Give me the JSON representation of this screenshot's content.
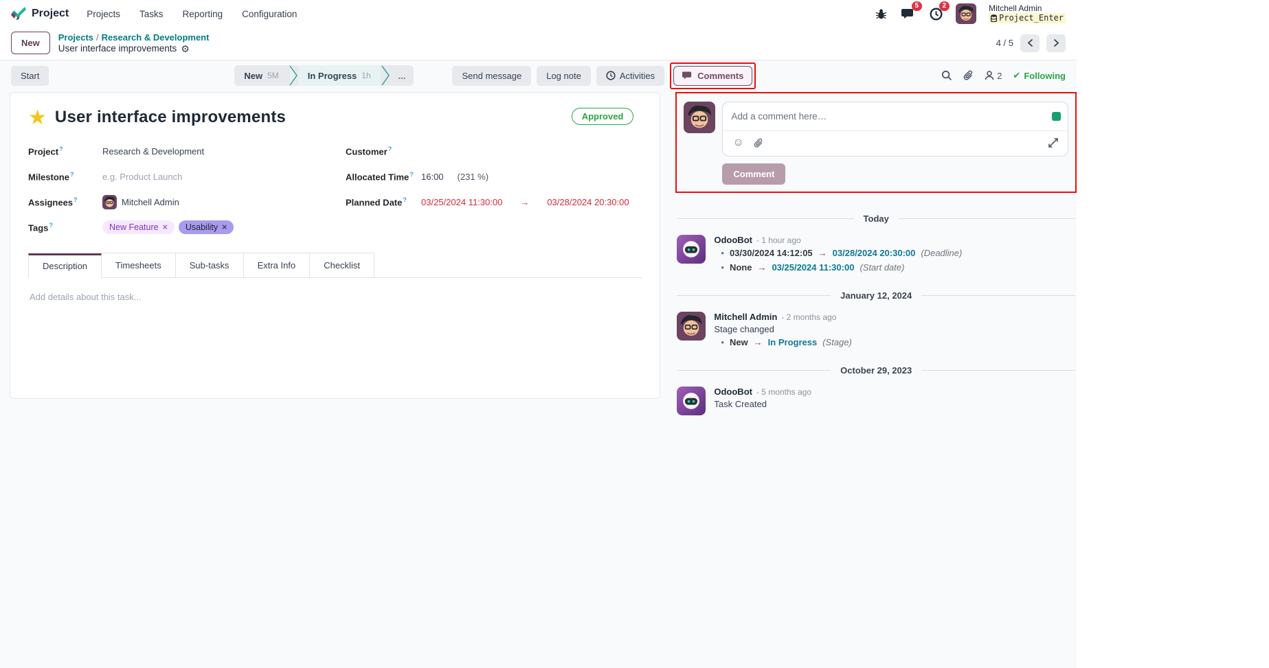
{
  "icons": {
    "star": "★",
    "gear": "⚙",
    "check": "✔",
    "smiley": "☺",
    "arrow": "→",
    "bullet": "•",
    "help": "?",
    "close": "×",
    "ellipsis": "..."
  },
  "brand": {
    "app": "Project"
  },
  "navbar": {
    "menus": [
      {
        "label": "Projects"
      },
      {
        "label": "Tasks"
      },
      {
        "label": "Reporting"
      },
      {
        "label": "Configuration"
      }
    ],
    "systray": {
      "messages_badge": "5",
      "activities_badge": "2",
      "user_name": "Mitchell Admin",
      "database": "Project_Enter"
    }
  },
  "breadcrumb": {
    "new_button": "New",
    "link_root": "Projects",
    "separator": "/",
    "link_parent": "Research & Development",
    "current": "User interface improvements",
    "pager_value": "4 / 5"
  },
  "statusbar": {
    "start_button": "Start",
    "stages": [
      {
        "label": "New",
        "duration": "5M"
      },
      {
        "label": "In Progress",
        "duration": "1h"
      }
    ],
    "send_message": "Send message",
    "log_note": "Log note",
    "activities": "Activities",
    "comments": "Comments",
    "followers_count": "2",
    "following": "Following"
  },
  "task": {
    "title": "User interface improvements",
    "status_badge": "Approved",
    "fields": {
      "project": {
        "label": "Project",
        "value": "Research & Development"
      },
      "milestone": {
        "label": "Milestone",
        "placeholder": "e.g. Product Launch"
      },
      "assignees": {
        "label": "Assignees",
        "value": "Mitchell Admin"
      },
      "tags": {
        "label": "Tags",
        "items": [
          {
            "label": "New Feature"
          },
          {
            "label": "Usability"
          }
        ]
      },
      "customer": {
        "label": "Customer"
      },
      "allocated_time": {
        "label": "Allocated Time",
        "value": "16:00",
        "extra": "(231 %)"
      },
      "planned_date": {
        "label": "Planned Date",
        "start": "03/25/2024 11:30:00",
        "end": "03/28/2024 20:30:00"
      }
    },
    "tabs": [
      {
        "label": "Description"
      },
      {
        "label": "Timesheets"
      },
      {
        "label": "Sub-tasks"
      },
      {
        "label": "Extra Info"
      },
      {
        "label": "Checklist"
      }
    ],
    "description_placeholder": "Add details about this task..."
  },
  "chatter": {
    "composer": {
      "placeholder": "Add a comment here…",
      "button": "Comment"
    },
    "groups": [
      {
        "date": "Today",
        "messages": [
          {
            "author": "OdooBot",
            "time": "- 1 hour ago",
            "changes": [
              {
                "old": "03/30/2024 14:12:05",
                "new": "03/28/2024 20:30:00",
                "field": "(Deadline)"
              },
              {
                "old": "None",
                "new": "03/25/2024 11:30:00",
                "field": "(Start date)"
              }
            ]
          }
        ]
      },
      {
        "date": "January 12, 2024",
        "messages": [
          {
            "author": "Mitchell Admin",
            "time": "- 2 months ago",
            "body": "Stage changed",
            "changes": [
              {
                "old": "New",
                "new": "In Progress",
                "field": "(Stage)"
              }
            ]
          }
        ]
      },
      {
        "date": "October 29, 2023",
        "messages": [
          {
            "author": "OdooBot",
            "time": "- 5 months ago",
            "body": "Task Created",
            "changes": []
          }
        ]
      }
    ]
  }
}
